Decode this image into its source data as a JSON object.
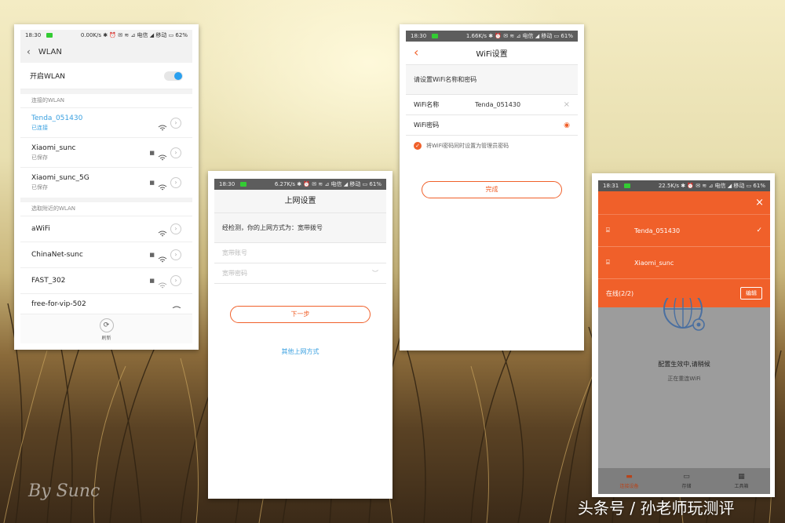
{
  "screen1": {
    "status": {
      "time": "18:30",
      "right": "0.00K/s ✱ ⏰ ✉ ≋ ⊿ 电信 ◢ 移动 ▭ 62%"
    },
    "title": "WLAN",
    "toggle_label": "开启WLAN",
    "connected_header": "连接的WLAN",
    "saved": [
      {
        "name": "Tenda_051430",
        "status": "已连接"
      },
      {
        "name": "Xiaomi_sunc",
        "status": "已保存"
      },
      {
        "name": "Xiaomi_sunc_5G",
        "status": "已保存"
      }
    ],
    "nearby_header": "选取附近的WLAN",
    "nearby": [
      "aWiFi",
      "ChinaNet-sunc",
      "FAST_302",
      "free-for-vip-502"
    ],
    "refresh_label": "刷新"
  },
  "screen2": {
    "status": {
      "time": "18:30",
      "right": "6.27K/s ✱ ⏰ ✉ ≋ ⊿ 电信 ◢ 移动 ▭ 61%"
    },
    "title": "上网设置",
    "detect_text": "经检测，你的上网方式为：宽带拨号",
    "account_placeholder": "宽带账号",
    "password_placeholder": "宽带密码",
    "next_button": "下一步",
    "other_link": "其他上网方式"
  },
  "screen3": {
    "status": {
      "time": "18:30",
      "right": "1.66K/s ✱ ⏰ ✉ ≋ ⊿ 电信 ◢ 移动 ▭ 61%"
    },
    "title": "WiFi设置",
    "subtitle": "请设置WiFi名称和密码",
    "name_label": "WiFi名称",
    "name_value": "Tenda_051430",
    "password_label": "WiFi密码",
    "checkbox_label": "将WiFi密码同时设置为管理员密码",
    "done_button": "完成"
  },
  "screen4": {
    "status": {
      "time": "18:31",
      "right": "22.5K/s ✱ ⏰ ✉ ≋ ⊿ 电信 ◢ 移动 ▭ 61%"
    },
    "networks": [
      "Tenda_051430",
      "Xiaomi_sunc"
    ],
    "online_label": "在线(2/2)",
    "edit_button": "编辑",
    "config_text": "配置生效中,请稍候",
    "reconnect_text": "正在重连WiFi",
    "nav": [
      "连接设备",
      "存储",
      "工具箱"
    ]
  },
  "watermark_left": "By Sunc",
  "watermark_right": "头条号 / 孙老师玩测评",
  "colors": {
    "accent_orange": "#f0602a",
    "link_blue": "#3aa0e0",
    "toggle_blue": "#2aa0ef"
  }
}
